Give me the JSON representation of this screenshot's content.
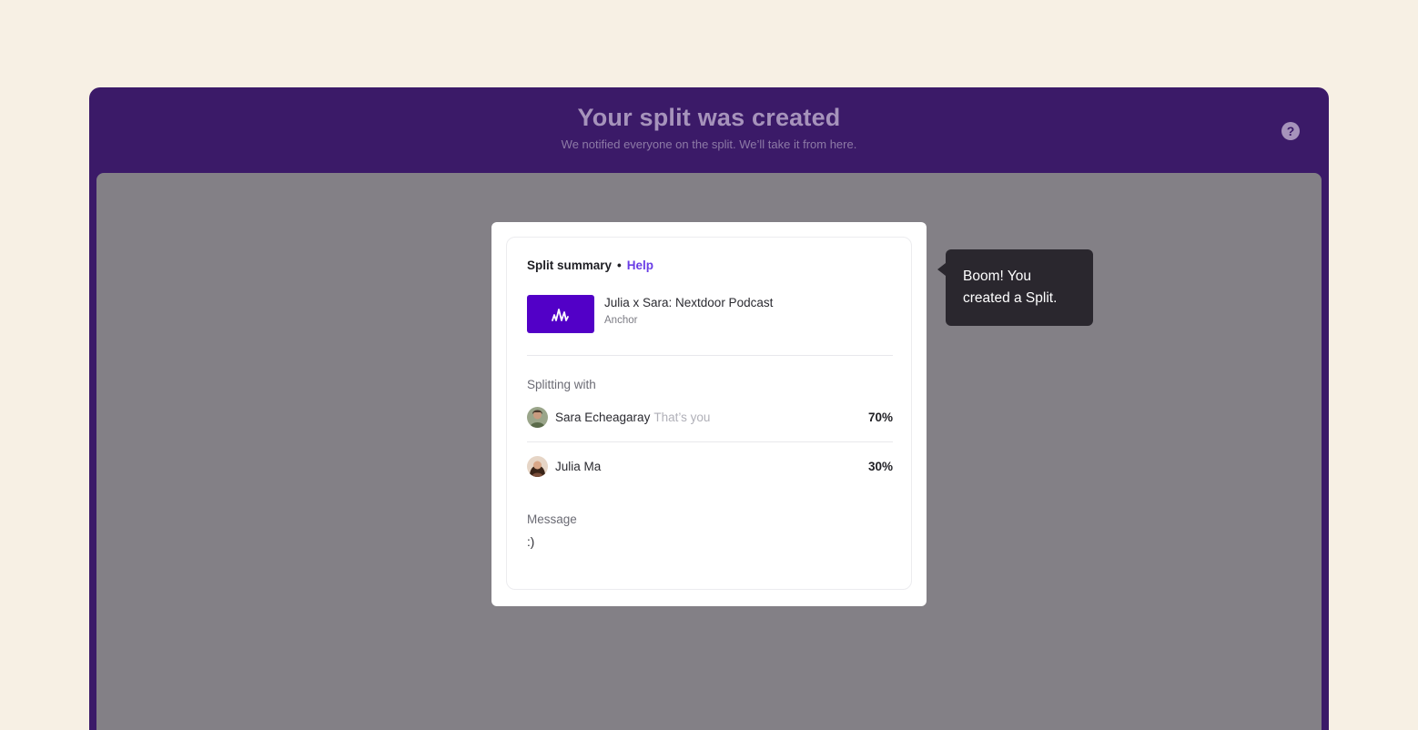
{
  "header": {
    "title": "Your split was created",
    "subtitle": "We notified everyone on the split. We’ll take it from here.",
    "help_glyph": "?"
  },
  "summary": {
    "title": "Split summary",
    "separator": "•",
    "help_link": "Help",
    "podcast": {
      "title": "Julia x Sara: Nextdoor Podcast",
      "source": "Anchor",
      "icon": "anchor-logo-icon",
      "thumb_color": "#5200c7"
    },
    "splitting_label": "Splitting with",
    "people": [
      {
        "name": "Sara Echeagaray",
        "note": "That’s you",
        "percent": "70%"
      },
      {
        "name": "Julia Ma",
        "note": "",
        "percent": "30%"
      }
    ],
    "message_label": "Message",
    "message": ":)"
  },
  "tooltip": {
    "text_line1": "Boom! You",
    "text_line2": "created a Split."
  },
  "colors": {
    "background": "#f7f0e4",
    "window": "#3b1a68",
    "overlay": "#838086",
    "accent": "#6a3ee6",
    "tooltip": "#2a272e"
  }
}
